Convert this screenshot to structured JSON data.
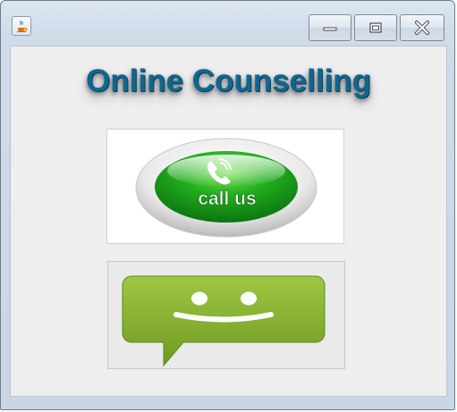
{
  "window": {
    "controls": {
      "minimize": "minimize",
      "maximize": "maximize",
      "close": "close"
    }
  },
  "main": {
    "heading": "Online Counselling",
    "call_button": {
      "label": "call us",
      "icon": "phone-icon"
    },
    "chat_button": {
      "icon": "smiley-chat-icon"
    }
  },
  "colors": {
    "heading": "#10668f",
    "call_green": "#19a01f",
    "chat_green": "#8ab534"
  }
}
